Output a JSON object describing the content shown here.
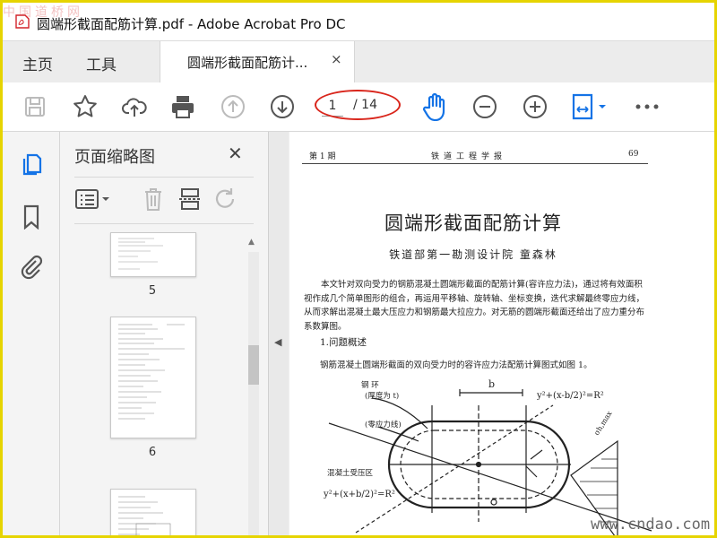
{
  "window": {
    "title": "圆端形截面配筋计算.pdf - Adobe Acrobat Pro DC",
    "watermark": "中国道桥网"
  },
  "tabs": {
    "home": "主页",
    "tools": "工具",
    "document": "圆端形截面配筋计...",
    "close": "×"
  },
  "toolbar": {
    "page_current": "1",
    "page_total": "/ 14",
    "icons": [
      "save-icon",
      "bookmark-star-icon",
      "cloud-upload-icon",
      "print-icon",
      "page-up-icon",
      "page-down-icon",
      "hand-tool-icon",
      "zoom-out-icon",
      "zoom-in-icon",
      "fit-page-icon",
      "more-icon"
    ]
  },
  "left_rail": {
    "icons": [
      "page-thumbnails-icon",
      "bookmarks-icon",
      "attachments-icon"
    ]
  },
  "thumbnails_panel": {
    "title": "页面缩略图",
    "close": "✕",
    "pages": [
      "5",
      "6"
    ]
  },
  "document": {
    "header_left": "第 1 期",
    "header_center": "铁道工程学报",
    "header_right": "69",
    "title": "圆端形截面配筋计算",
    "author": "铁道部第一勘测设计院    童森林",
    "abstract": "本文针对双向受力的钢筋混凝土圆端形截面的配筋计算(容许应力法)，通过将有效面积视作成几个简单图形的组合，再运用平移轴、旋转轴、坐标变换，迭代求解最终零应力线，从而求解出混凝土最大压应力和钢筋最大拉应力。对无筋的圆端形截面还给出了应力重分布系数算图。",
    "section1": "1.问题概述",
    "body1": "钢筋混凝土圆端形截面的双向受力时的容许应力法配筋计算图式如图 1。",
    "diagram_labels": {
      "rebar": "钢    环",
      "thickness": "(厚度为 t)",
      "zero_line": "(零应力线)",
      "compression": "混凝土受压区",
      "eq_right": "y²+(x-b/2)²=R²",
      "eq_left": "y²+(x+b/2)²=R²",
      "b": "b",
      "sigma": "σh,max"
    },
    "site_watermark": "www.cndao.com"
  }
}
